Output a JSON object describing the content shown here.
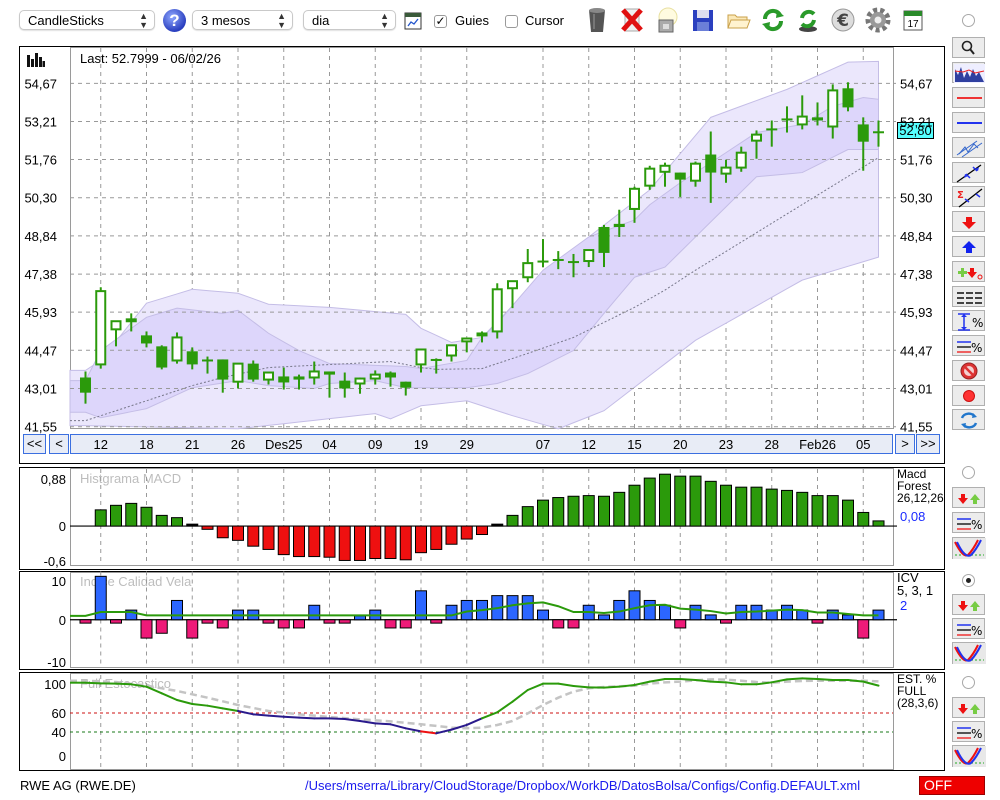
{
  "toolbar": {
    "chart_type": "CandleSticks",
    "help_icon": "?",
    "period": "3 mesos",
    "interval": "dia",
    "guides_label": "Guies",
    "guides_checked": true,
    "cursor_label": "Cursor",
    "cursor_checked": false,
    "calendar_day": "17",
    "icons": [
      "chart-window-icon",
      "trash-icon",
      "delete-icon",
      "lamp-icon",
      "save-icon",
      "folder-icon",
      "refresh-icon",
      "sync-icon",
      "euro-icon",
      "gear-icon",
      "calendar-icon"
    ]
  },
  "main": {
    "last_label": "Last: 52.7999 - 06/02/26",
    "current_price_label": "52,80",
    "nav": {
      "first": "<<",
      "prev": "<",
      "next": ">",
      "last": ">>"
    }
  },
  "sidebar_main_tools": [
    "zoom-icon",
    "chart-thumbnail-icon",
    "red-line-icon",
    "blue-line-icon",
    "channel-icon",
    "trend-lines-icon",
    "sigma-lines-icon",
    "sell-arrow-icon",
    "buy-arrow-icon",
    "add-signal-icon",
    "grid-lines-icon",
    "percent-range-icon",
    "percent-lines-icon",
    "stop-icon",
    "record-icon",
    "swap-icon"
  ],
  "indicators": [
    {
      "title": "Histgrama MACD",
      "legend": [
        "Macd",
        "Forest",
        "26,12,26"
      ],
      "value": "0,08",
      "selected": false
    },
    {
      "title": "Indice Calidad Vela",
      "legend": [
        "ICV",
        "5, 3, 1"
      ],
      "value": "2",
      "selected": true
    },
    {
      "title": "Full Estocastico",
      "legend": [
        "EST. %",
        "FULL",
        "(28,3,6)"
      ],
      "value": "",
      "selected": false
    }
  ],
  "status": {
    "instrument": "RWE AG (RWE.DE)",
    "config_path": "/Users/mserra/Library/CloudStorage/Dropbox/WorkDB/DatosBolsa/Configs/Config.DEFAULT.xml",
    "mode": "OFF"
  },
  "colors": {
    "candle": "#2b9a0b",
    "band_outer": "#ebe7fc",
    "band_inner": "#ddd6fb",
    "band_stroke": "#c4bde6",
    "ma_dotted": "#77778a",
    "macd_pos": "#2b9a0b",
    "macd_neg": "#ef1010",
    "icv_pos": "#2c66ff",
    "icv_neg": "#ee1a78",
    "icv_line": "#2b9a0b",
    "stoch_high": "#2b9a0b",
    "stoch_mid": "#2a1a8c",
    "stoch_low": "#ee1111",
    "stoch_d": "#c4c4c4",
    "price_badge": "#55ffff",
    "off_badge": "#ee0000",
    "link": "#1a1aee"
  },
  "chart_data": [
    {
      "type": "candlestick",
      "ylim": [
        41.5,
        56.02
      ],
      "y_ticks": [
        {
          "value": 54.67,
          "label": "54,67"
        },
        {
          "value": 53.21,
          "label": "53,21"
        },
        {
          "value": 51.76,
          "label": "51,76"
        },
        {
          "value": 50.3,
          "label": "50,30"
        },
        {
          "value": 48.84,
          "label": "48,84"
        },
        {
          "value": 47.38,
          "label": "47,38"
        },
        {
          "value": 45.93,
          "label": "45,93"
        },
        {
          "value": 44.47,
          "label": "44,47"
        },
        {
          "value": 43.01,
          "label": "43,01"
        },
        {
          "value": 41.55,
          "label": "41,55"
        }
      ],
      "x_ticks": [
        {
          "bar": 1,
          "label": "12"
        },
        {
          "bar": 4,
          "label": "18"
        },
        {
          "bar": 7,
          "label": "21"
        },
        {
          "bar": 10,
          "label": "26"
        },
        {
          "bar": 13,
          "label": "Des25"
        },
        {
          "bar": 16,
          "label": "04"
        },
        {
          "bar": 19,
          "label": "09"
        },
        {
          "bar": 22,
          "label": "19"
        },
        {
          "bar": 25,
          "label": "29"
        },
        {
          "bar": 30,
          "label": "07"
        },
        {
          "bar": 33,
          "label": "12"
        },
        {
          "bar": 36,
          "label": "15"
        },
        {
          "bar": 39,
          "label": "20"
        },
        {
          "bar": 42,
          "label": "23"
        },
        {
          "bar": 45,
          "label": "28"
        },
        {
          "bar": 48,
          "label": "Feb26"
        },
        {
          "bar": 51,
          "label": "05"
        }
      ],
      "grid": true,
      "ohlc": [
        [
          43.43,
          43.66,
          42.43,
          42.85
        ],
        [
          43.93,
          46.88,
          43.77,
          46.73
        ],
        [
          45.27,
          45.58,
          44.62,
          45.58
        ],
        [
          45.69,
          45.88,
          45.19,
          45.54
        ],
        [
          45.04,
          45.19,
          44.58,
          44.73
        ],
        [
          44.62,
          44.66,
          43.74,
          43.81
        ],
        [
          44.08,
          45.15,
          43.96,
          44.96
        ],
        [
          44.43,
          44.58,
          43.74,
          43.93
        ],
        [
          44.12,
          44.23,
          43.58,
          44.04
        ],
        [
          44.12,
          44.12,
          42.85,
          43.35
        ],
        [
          43.27,
          43.96,
          43.01,
          43.96
        ],
        [
          43.96,
          44.08,
          43.27,
          43.35
        ],
        [
          43.35,
          43.62,
          43.16,
          43.62
        ],
        [
          43.47,
          43.81,
          42.97,
          43.24
        ],
        [
          43.47,
          43.54,
          42.97,
          43.35
        ],
        [
          43.43,
          44.04,
          43.16,
          43.66
        ],
        [
          43.66,
          43.66,
          42.66,
          43.54
        ],
        [
          43.31,
          43.62,
          42.66,
          43.01
        ],
        [
          43.2,
          43.43,
          42.81,
          43.39
        ],
        [
          43.39,
          43.7,
          43.16,
          43.54
        ],
        [
          43.62,
          43.66,
          43.08,
          43.43
        ],
        [
          43.27,
          43.27,
          42.74,
          43.04
        ],
        [
          43.93,
          44.5,
          43.62,
          44.5
        ],
        [
          44.1,
          44.16,
          43.58,
          44.1
        ],
        [
          44.27,
          44.66,
          44.04,
          44.66
        ],
        [
          44.81,
          44.92,
          44.39,
          44.92
        ],
        [
          45.15,
          45.19,
          44.77,
          45.0
        ],
        [
          45.19,
          47.03,
          44.92,
          46.8
        ],
        [
          46.84,
          47.11,
          46.08,
          47.11
        ],
        [
          47.26,
          48.34,
          47.07,
          47.8
        ],
        [
          47.86,
          48.72,
          47.65,
          47.86
        ],
        [
          47.92,
          48.26,
          47.57,
          47.92
        ],
        [
          47.88,
          48.15,
          47.26,
          47.8
        ],
        [
          47.88,
          48.3,
          47.65,
          48.3
        ],
        [
          49.18,
          49.26,
          47.65,
          48.19
        ],
        [
          49.3,
          49.84,
          48.8,
          49.18
        ],
        [
          49.87,
          50.72,
          49.34,
          50.64
        ],
        [
          50.76,
          51.52,
          50.6,
          51.41
        ],
        [
          51.29,
          51.64,
          50.72,
          51.52
        ],
        [
          51.26,
          51.26,
          50.33,
          50.99
        ],
        [
          50.95,
          51.68,
          50.72,
          51.6
        ],
        [
          51.95,
          52.83,
          50.1,
          51.26
        ],
        [
          51.22,
          51.75,
          50.87,
          51.45
        ],
        [
          51.45,
          52.25,
          51.29,
          52.02
        ],
        [
          52.48,
          52.87,
          51.79,
          52.71
        ],
        [
          52.91,
          53.25,
          52.25,
          52.91
        ],
        [
          53.29,
          53.79,
          52.79,
          53.29
        ],
        [
          53.1,
          54.21,
          52.91,
          53.4
        ],
        [
          53.37,
          53.94,
          53.06,
          53.25
        ],
        [
          53.02,
          54.63,
          52.56,
          54.4
        ],
        [
          54.48,
          54.71,
          53.6,
          53.75
        ],
        [
          53.1,
          53.37,
          51.33,
          52.44
        ],
        [
          52.8,
          53.25,
          52.25,
          52.8
        ]
      ],
      "last_price": 52.8,
      "bands": {
        "outer_upper": [
          [
            0,
            43.7
          ],
          [
            1,
            44.08
          ],
          [
            4,
            46.27
          ],
          [
            7,
            46.8
          ],
          [
            10,
            46.65
          ],
          [
            12,
            46.23
          ],
          [
            16,
            46.11
          ],
          [
            21,
            45.84
          ],
          [
            22,
            45.31
          ],
          [
            24,
            44.77
          ],
          [
            26,
            44.96
          ],
          [
            29,
            46.77
          ],
          [
            33,
            48.8
          ],
          [
            37,
            50.6
          ],
          [
            41,
            53.37
          ],
          [
            46,
            54.44
          ],
          [
            50,
            55.48
          ],
          [
            52,
            55.51
          ]
        ],
        "inner_upper": [
          [
            0,
            43.31
          ],
          [
            1,
            44.46
          ],
          [
            4,
            45.73
          ],
          [
            6,
            46.08
          ],
          [
            9,
            45.88
          ],
          [
            10,
            46.0
          ],
          [
            12,
            45.12
          ],
          [
            14,
            44.46
          ],
          [
            16,
            43.96
          ],
          [
            21,
            43.85
          ],
          [
            22,
            43.77
          ],
          [
            25,
            44.08
          ],
          [
            26,
            44.96
          ],
          [
            27,
            45.5
          ],
          [
            30,
            47.53
          ],
          [
            33,
            48.8
          ],
          [
            36,
            49.45
          ],
          [
            37,
            50.03
          ],
          [
            39,
            50.87
          ],
          [
            44,
            52.79
          ],
          [
            47,
            53.1
          ],
          [
            49,
            53.79
          ],
          [
            51,
            54.13
          ],
          [
            52,
            54.06
          ]
        ],
        "inner_lower": [
          [
            0,
            42.1
          ],
          [
            1,
            41.89
          ],
          [
            4,
            42.24
          ],
          [
            7,
            43.04
          ],
          [
            10,
            43.31
          ],
          [
            12,
            43.12
          ],
          [
            15,
            43.01
          ],
          [
            16,
            43.2
          ],
          [
            19,
            43.31
          ],
          [
            21,
            43.04
          ],
          [
            25,
            43.04
          ],
          [
            27,
            43.2
          ],
          [
            29,
            43.58
          ],
          [
            32,
            44.46
          ],
          [
            34,
            45.88
          ],
          [
            36,
            47.26
          ],
          [
            38,
            47.65
          ],
          [
            44,
            51.1
          ],
          [
            47,
            51.26
          ],
          [
            50,
            52.14
          ],
          [
            52,
            52.14
          ]
        ],
        "outer_lower": [
          [
            0,
            41.59
          ],
          [
            10,
            41.47
          ],
          [
            19,
            42.05
          ],
          [
            20,
            41.85
          ],
          [
            22,
            42.35
          ],
          [
            25,
            42.54
          ],
          [
            28,
            41.97
          ],
          [
            31,
            41.47
          ],
          [
            34,
            42.16
          ],
          [
            40,
            44.85
          ],
          [
            47,
            47.15
          ],
          [
            52,
            48.03
          ]
        ],
        "ma": [
          [
            0,
            41.78
          ],
          [
            4,
            42.54
          ],
          [
            7,
            43.12
          ],
          [
            9,
            43.43
          ],
          [
            12,
            43.81
          ],
          [
            20,
            44.04
          ],
          [
            22,
            43.81
          ],
          [
            23,
            43.74
          ],
          [
            26,
            43.77
          ],
          [
            29,
            44.35
          ],
          [
            32,
            44.96
          ],
          [
            36,
            46.11
          ],
          [
            38,
            46.77
          ],
          [
            40,
            47.53
          ],
          [
            52,
            51.83
          ]
        ]
      }
    },
    {
      "type": "bar",
      "title": "Histgrama MACD",
      "ylim": [
        -0.6,
        0.88
      ],
      "y_ticks": [
        {
          "value": 0.88,
          "label": "0,88"
        },
        {
          "value": 0,
          "label": "0"
        },
        {
          "value": -0.6,
          "label": "-0,6"
        }
      ],
      "first_bar": 1,
      "values": [
        0.25,
        0.32,
        0.35,
        0.29,
        0.165,
        0.13,
        0.03,
        -0.05,
        -0.18,
        -0.22,
        -0.31,
        -0.36,
        -0.44,
        -0.47,
        -0.47,
        -0.48,
        -0.53,
        -0.53,
        -0.5,
        -0.5,
        -0.52,
        -0.41,
        -0.36,
        -0.28,
        -0.2,
        -0.13,
        0.03,
        0.165,
        0.3,
        0.4,
        0.44,
        0.46,
        0.47,
        0.46,
        0.52,
        0.63,
        0.74,
        0.8,
        0.77,
        0.77,
        0.69,
        0.63,
        0.6,
        0.6,
        0.57,
        0.55,
        0.52,
        0.47,
        0.47,
        0.4,
        0.21,
        0.08
      ]
    },
    {
      "type": "bar",
      "title": "Indice Calidad Vela",
      "ylim": [
        -10,
        10
      ],
      "y_ticks": [
        {
          "value": 10,
          "label": "10"
        },
        {
          "value": 0,
          "label": "0"
        },
        {
          "value": -10,
          "label": "-10"
        }
      ],
      "first_bar": 0,
      "values": [
        -0.7,
        9,
        -0.7,
        2,
        -3.8,
        -2.8,
        4,
        -3.8,
        -0.7,
        -1.7,
        2,
        2,
        -0.7,
        -1.7,
        -1.7,
        3,
        -0.7,
        -0.7,
        0.8,
        2,
        -1.7,
        -1.7,
        6,
        -0.7,
        3,
        4,
        4,
        5,
        5,
        5,
        2,
        -1.7,
        -1.7,
        3,
        1,
        4,
        6,
        4,
        3,
        -1.7,
        3,
        1,
        -0.7,
        3,
        3,
        2,
        3,
        2,
        -0.7,
        2,
        1,
        -3.8,
        2
      ],
      "signal": [
        0.8,
        1.6,
        1.6,
        1.6,
        0.9,
        0.9,
        0.9,
        0.9,
        0.9,
        0.9,
        0.9,
        0.9,
        0.9,
        0.9,
        0.9,
        0.9,
        0.9,
        0.9,
        0.9,
        0.9,
        0.9,
        0.9,
        0.9,
        0.9,
        0.9,
        1.7,
        2.0,
        2.4,
        3.0,
        3.4,
        3.6,
        2.8,
        1.6,
        1.6,
        1.4,
        1.7,
        2.4,
        3.0,
        3.1,
        2.3,
        2.1,
        1.8,
        1.3,
        1.6,
        1.7,
        1.9,
        2.1,
        2.0,
        1.5,
        1.5,
        1.2,
        0.9,
        0.9
      ]
    },
    {
      "type": "line",
      "title": "Full Estocastico",
      "ylim": [
        0,
        100
      ],
      "y_ticks": [
        {
          "value": 100,
          "label": "100"
        },
        {
          "value": 60,
          "label": "60"
        },
        {
          "value": 40,
          "label": "40"
        },
        {
          "value": 0,
          "label": "0"
        }
      ],
      "levels": {
        "upper": 60,
        "lower": 40
      },
      "k": [
        91.9,
        91.2,
        90.9,
        90.2,
        87.7,
        80.7,
        73.7,
        69.5,
        67.7,
        64.9,
        62.1,
        58.6,
        57.2,
        56.1,
        55.1,
        54.4,
        54.4,
        53.7,
        51.6,
        49.1,
        48.1,
        43.9,
        40.7,
        38.6,
        42.5,
        47.4,
        54.4,
        60.7,
        71.9,
        84.2,
        90.9,
        90.9,
        88.4,
        87.0,
        86.7,
        87.7,
        89.5,
        93.0,
        95.8,
        95.8,
        94.7,
        93.0,
        92.3,
        90.2,
        90.2,
        92.3,
        95.4,
        96.5,
        95.8,
        94.7,
        94.7,
        93.0,
        88.8
      ],
      "d": [
        94.0,
        93.3,
        92.6,
        90.7,
        88.8,
        86.0,
        83.2,
        79.7,
        76.1,
        72.3,
        68.4,
        65.3,
        62.1,
        60.4,
        58.6,
        57.2,
        55.8,
        54.6,
        53.3,
        52.3,
        51.2,
        49.7,
        48.1,
        46.4,
        44.6,
        43.9,
        44.6,
        47.4,
        51.6,
        59.6,
        68.4,
        76.1,
        82.5,
        86.0,
        87.4,
        88.1,
        88.8,
        90.9,
        92.3,
        93.0,
        94.4,
        95.4,
        95.1,
        94.0,
        92.6,
        91.9,
        93.0,
        93.7,
        94.0,
        94.0,
        94.0,
        94.0,
        93.3
      ]
    }
  ]
}
